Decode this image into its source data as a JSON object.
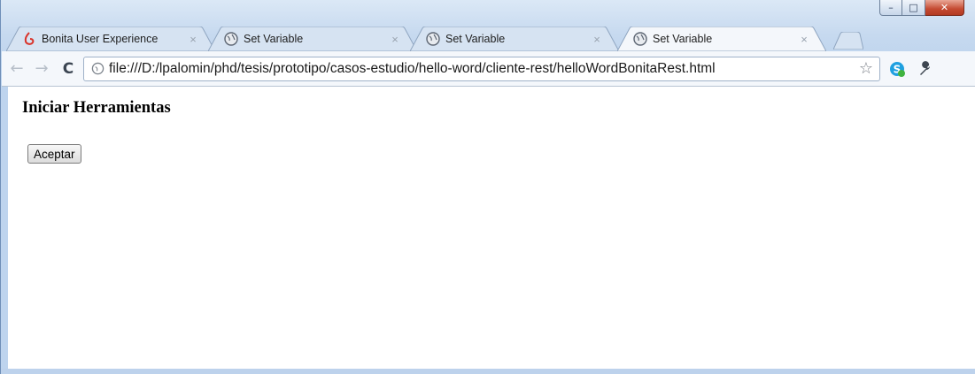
{
  "window": {
    "controls": {
      "minimize": "–",
      "maximize": "□",
      "close": "✕"
    }
  },
  "tabs": [
    {
      "title": "Bonita User Experience",
      "icon": "bonita-logo-icon",
      "active": false
    },
    {
      "title": "Set Variable",
      "icon": "globe-icon",
      "active": false
    },
    {
      "title": "Set Variable",
      "icon": "globe-icon",
      "active": false
    },
    {
      "title": "Set Variable",
      "icon": "globe-icon",
      "active": true
    }
  ],
  "tab_close_glyph": "×",
  "toolbar": {
    "back": "←",
    "forward": "→",
    "reload": "C",
    "url": "file:///D:/lpalomin/phd/tesis/prototipo/casos-estudio/hello-word/cliente-rest/helloWordBonitaRest.html",
    "star": "☆"
  },
  "page": {
    "heading": "Iniciar Herramientas",
    "button_label": "Aceptar"
  }
}
